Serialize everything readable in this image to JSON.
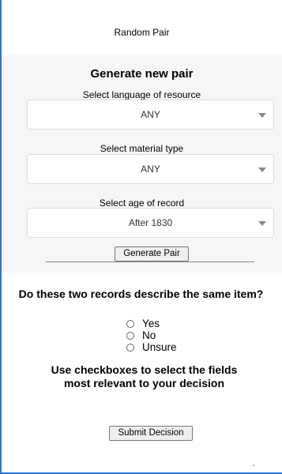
{
  "header": {
    "title": "Random Pair"
  },
  "form": {
    "title": "Generate new pair",
    "fields": [
      {
        "label": "Select language of resource",
        "value": "ANY"
      },
      {
        "label": "Select material type",
        "value": "ANY"
      },
      {
        "label": "Select age of record",
        "value": "After 1830"
      }
    ],
    "generate_label": "Generate Pair"
  },
  "decision": {
    "question": "Do these two records describe the same item?",
    "options": [
      "Yes",
      "No",
      "Unsure"
    ],
    "instruction": "Use checkboxes to select the fields most relevant to your decision",
    "submit_label": "Submit Decision"
  },
  "icons": {
    "dropdown": "chevron-down-icon",
    "radio": "radio-unchecked-icon"
  },
  "colors": {
    "frame_border": "#2f6fd6",
    "panel_background": "#f6f6f6"
  }
}
